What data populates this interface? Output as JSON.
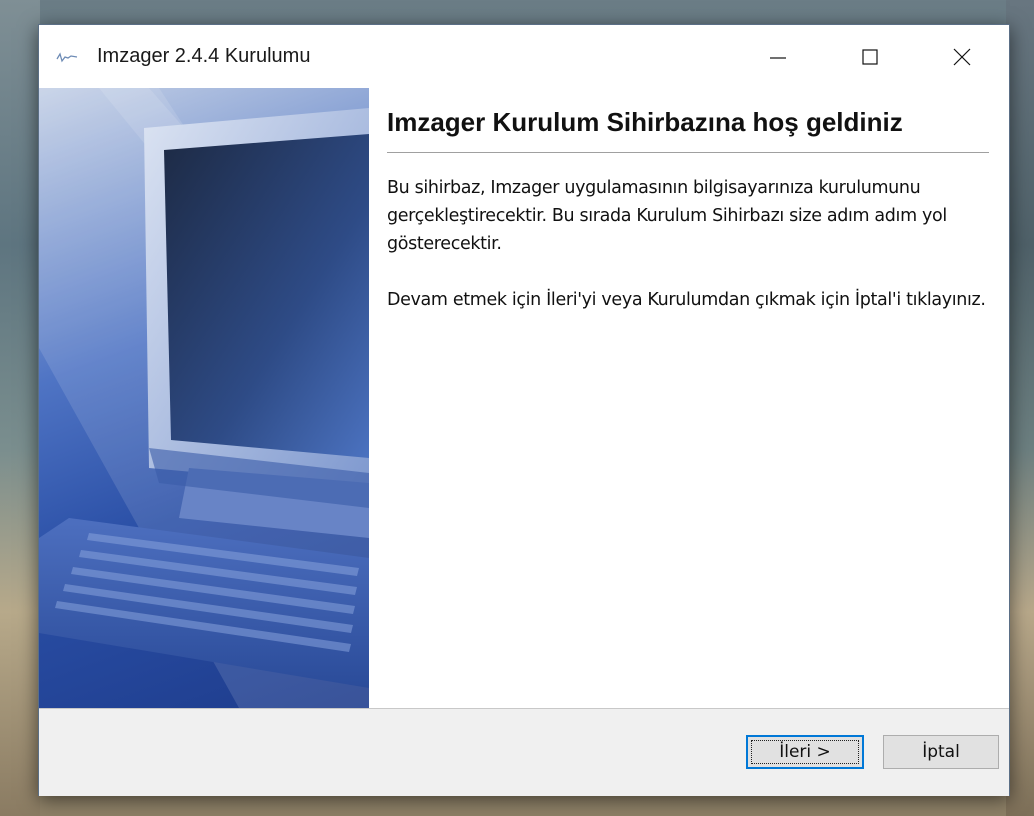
{
  "window": {
    "title": "Imzager 2.4.4 Kurulumu",
    "controls": {
      "minimize": "minimize",
      "maximize": "maximize",
      "close": "close"
    }
  },
  "content": {
    "heading": "Imzager Kurulum Sihirbazına hoş geldiniz",
    "paragraph1": "Bu sihirbaz, Imzager uygulamasının bilgisayarınıza kurulumunu gerçekleştirecektir. Bu sırada Kurulum Sihirbazı size adım adım yol gösterecektir.",
    "paragraph2": "Devam etmek için İleri'yi veya Kurulumdan çıkmak için İptal'i tıklayınız."
  },
  "footer": {
    "next_label": "İleri >",
    "cancel_label": "İptal"
  },
  "colors": {
    "accent": "#0078d7",
    "banner_dark": "#1e3c8c",
    "banner_light": "#c4d0e6",
    "footer_bg": "#f0f0f0"
  }
}
